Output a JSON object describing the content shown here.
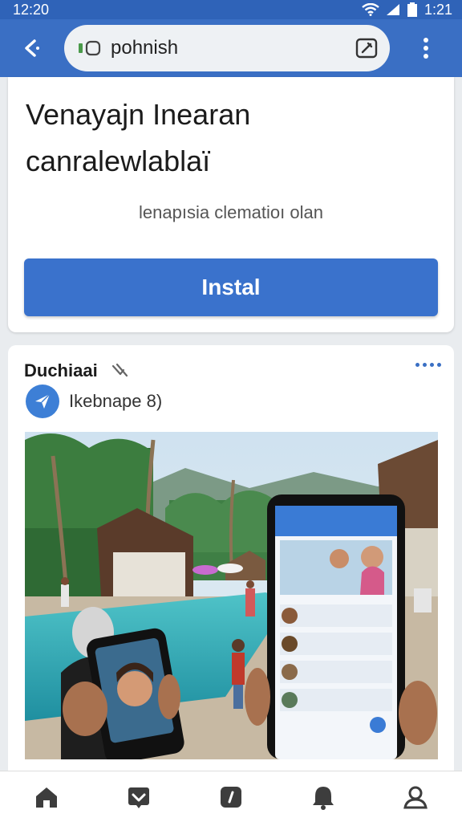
{
  "status_bar": {
    "time_left": "12:20",
    "time_right": "1:21"
  },
  "browser": {
    "url": "pohnish",
    "back_icon": "back-icon",
    "menu_icon": "more-vert-icon"
  },
  "install_banner": {
    "title_line1": "Venayajn Inearan",
    "title_line2": "canralewlablaï",
    "subtitle": "lenapısia clematioı olan",
    "button_label": "Instal",
    "accent": "#3a72cc"
  },
  "post": {
    "author": "Duchiaai",
    "meta": "Ikebnape 8)",
    "image_alt": "Resort pool with people holding phones showing a social app"
  },
  "bottom_nav": [
    "home-icon",
    "inbox-icon",
    "explore-icon",
    "notifications-icon",
    "profile-icon"
  ],
  "colors": {
    "app_bar": "#3a6fc4",
    "status_bar": "#2f63b8"
  }
}
